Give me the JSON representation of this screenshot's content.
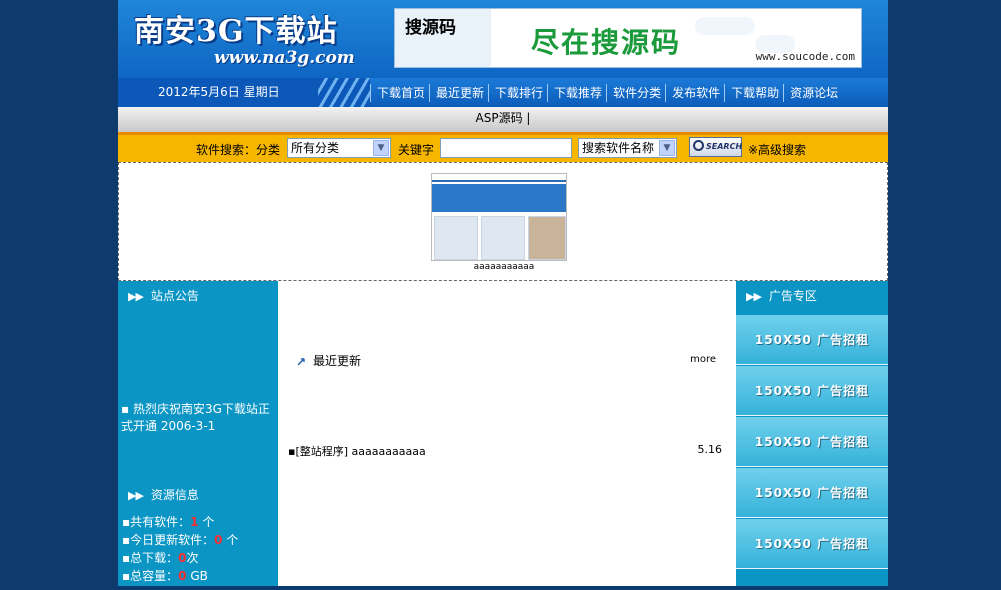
{
  "header": {
    "site_title": "南安3G下载站",
    "site_url": "www.na3g.com",
    "banner": {
      "brand": "搜源码",
      "slogan": "尽在搜源码",
      "url": "www.soucode.com"
    }
  },
  "navbar": {
    "date": "2012年5月6日 星期日",
    "items": [
      "下载首页",
      "最近更新",
      "下载排行",
      "下载推荐",
      "软件分类",
      "发布软件",
      "下载帮助",
      "资源论坛"
    ]
  },
  "subbar": {
    "text": "ASP源码 |"
  },
  "search": {
    "label": "软件搜索：分类",
    "category_selected": "所有分类",
    "keyword_label": "关键字",
    "keyword_value": "",
    "field_selected": "搜索软件名称",
    "button_label": "SEARCH",
    "advanced_label": "※高级搜索"
  },
  "promo": {
    "caption": "aaaaaaaaaaa"
  },
  "left": {
    "notice_title": "站点公告",
    "notice_text": "热烈庆祝南安3G下载站正式开通 2006-3-1",
    "stats_title": "资源信息",
    "stats": {
      "total_software_label": "共有软件：",
      "total_software_value": "1",
      "total_software_unit": "个",
      "today_updated_label": "今日更新软件：",
      "today_updated_value": "0",
      "today_updated_unit": "个",
      "total_downloads_label": "总下载：",
      "total_downloads_value": "0",
      "total_downloads_unit": "次",
      "total_size_label": "总容量：",
      "total_size_value": "0",
      "total_size_unit": "GB"
    }
  },
  "center": {
    "recent_title": "最近更新",
    "more_label": "more",
    "items": [
      {
        "title": "[整站程序] aaaaaaaaaaa",
        "date": "5.16"
      }
    ]
  },
  "right": {
    "title": "广告专区",
    "ads": [
      "150X50 广告招租",
      "150X50 广告招租",
      "150X50 广告招租",
      "150X50 广告招租",
      "150X50 广告招租"
    ]
  }
}
